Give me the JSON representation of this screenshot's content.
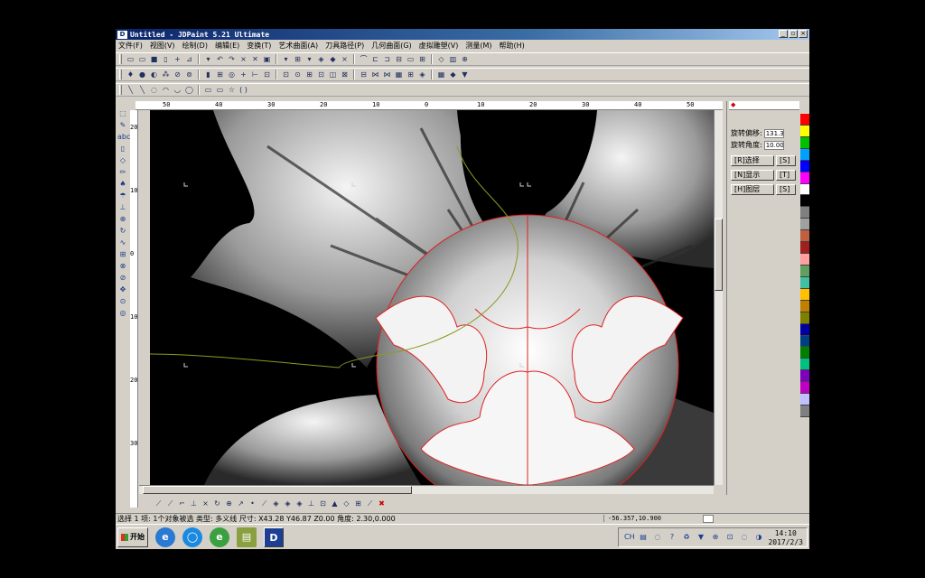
{
  "window": {
    "logo": "D",
    "title": "Untitled - JDPaint 5.21 Ultimate",
    "buttons": {
      "minimize": "_",
      "restore": "▫",
      "close": "×"
    }
  },
  "menu": [
    "文件(F)",
    "视图(V)",
    "绘制(D)",
    "编辑(E)",
    "变换(T)",
    "艺术曲面(A)",
    "刀具路径(P)",
    "几何曲面(G)",
    "虚拟雕塑(V)",
    "测量(M)",
    "帮助(H)"
  ],
  "toolbars": {
    "row1": [
      "▭",
      "▭",
      "■",
      "▯",
      "+",
      "⊿",
      "▾",
      "↶",
      "↷",
      "×",
      "✕",
      "▣",
      "▾",
      "⊞",
      "▾",
      "◈",
      "◆",
      "⨯",
      "⌒",
      "⊏",
      "⊐",
      "⊟",
      "▭",
      "⊞",
      "◇",
      "▥",
      "⊕"
    ],
    "row2": [
      "♦",
      "●",
      "◐",
      "⁂",
      "⊘",
      "⊚",
      "▮",
      "⊞",
      "◎",
      "+",
      "⊢",
      "⊡",
      "⊡",
      "⊙",
      "⊞",
      "⊡",
      "◫",
      "⊠",
      "⊟",
      "⋈",
      "⋈",
      "▦",
      "⊞",
      "◈",
      "▦",
      "◆",
      "▼"
    ],
    "row3": [
      "╲",
      "╲",
      "◌",
      "◠",
      "◡",
      "◯",
      "▭",
      "▭",
      "☆",
      "( )"
    ]
  },
  "left_tools": [
    "⬚",
    "✎",
    "abc",
    "▯",
    "◇",
    "✏",
    "♠",
    "☂",
    "⊥",
    "⊕",
    "↻",
    "∿",
    "⊞",
    "⊗",
    "⊘",
    "✥",
    "⊙",
    "◎"
  ],
  "ruler": {
    "h_ticks": [
      "50",
      "40",
      "30",
      "20",
      "10",
      "0",
      "10",
      "20",
      "30",
      "40",
      "50"
    ],
    "v_ticks": [
      "20",
      "10",
      "0",
      "10",
      "20",
      "30"
    ]
  },
  "right_panel": {
    "tab_icon": "◆",
    "fields": [
      {
        "label": "旋转偏移:",
        "value": "131.3"
      },
      {
        "label": "旋转角度:",
        "value": "10.00"
      }
    ],
    "buttons": [
      {
        "label": "[R]选择",
        "hint": "[S]"
      },
      {
        "label": "[N]显示",
        "hint": "[T]"
      },
      {
        "label": "[H]图层",
        "hint": "[S]"
      }
    ]
  },
  "palette": [
    "#ff0000",
    "#ffff00",
    "#00c000",
    "#00a0ff",
    "#0000ff",
    "#ff00ff",
    "#ffffff",
    "#000000",
    "#808080",
    "#a0a0a0",
    "#c06040",
    "#a02020",
    "#ffa0a0",
    "#60a060",
    "#40c0a0",
    "#ffc000",
    "#c08000",
    "#808000",
    "#0000a0",
    "#004080",
    "#008000",
    "#00c080",
    "#8000c0",
    "#c000c0",
    "#c0c0ff",
    "#808080"
  ],
  "bottom_tools": [
    "⟋",
    "⟋",
    "⌐",
    "⊥",
    "×",
    "↻",
    "⊕",
    "↗",
    "•",
    "⟋",
    "◈",
    "◈",
    "◈",
    "⊥",
    "⊡",
    "▲",
    "◇",
    "⊞",
    "⟋",
    "✖"
  ],
  "status": {
    "message": "选择 1 项: 1个对象被选 类型: 多义线 尺寸: X43.28 Y46.87 Z0.00 角度: 2.30,0.000",
    "coords": "-56.357,10.900"
  },
  "taskbar": {
    "start": "开始",
    "apps": [
      "e",
      "◯",
      "e",
      "▤"
    ],
    "active_app": "D",
    "tray_icons": [
      "CH",
      "▤",
      "◌",
      "?",
      "♻",
      "▼",
      "⊕",
      "⊡",
      "◌",
      "◑"
    ],
    "clock_time": "14:10",
    "clock_date": "2017/2/3"
  },
  "colors": {
    "spline_red": "#e02020",
    "path_green": "#8a9a20",
    "canvas_bg": "#000000"
  }
}
